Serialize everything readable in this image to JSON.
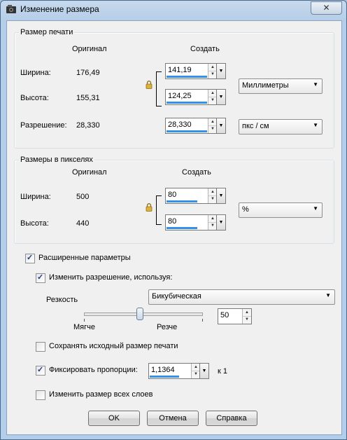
{
  "window": {
    "title": "Изменение размера",
    "close_glyph": "✕"
  },
  "print_size": {
    "group_title": "Размер печати",
    "col_original": "Оригинал",
    "col_create": "Создать",
    "width_label": "Ширина:",
    "width_original": "176,49",
    "width_value": "141,19",
    "height_label": "Высота:",
    "height_original": "155,31",
    "height_value": "124,25",
    "resolution_label": "Разрешение:",
    "resolution_original": "28,330",
    "resolution_value": "28,330",
    "units_selected": "Миллиметры",
    "res_units_selected": "пкс / см"
  },
  "pixel_size": {
    "group_title": "Размеры в пикселях",
    "col_original": "Оригинал",
    "col_create": "Создать",
    "width_label": "Ширина:",
    "width_original": "500",
    "width_value": "80",
    "height_label": "Высота:",
    "height_original": "440",
    "height_value": "80",
    "units_selected": "%"
  },
  "advanced": {
    "checkbox_label": "Расширенные параметры",
    "checked": true,
    "change_resolution_label": "Изменить разрешение, используя:",
    "change_resolution_checked": true,
    "sharpness_label": "Резкость",
    "method_selected": "Бикубическая",
    "slider_left_label": "Мягче",
    "slider_right_label": "Резче",
    "sharpness_value": "50",
    "keep_print_size_label": "Сохранять исходный размер печати",
    "keep_print_size_checked": false,
    "lock_aspect_label": "Фиксировать пропорции:",
    "lock_aspect_checked": true,
    "aspect_value": "1,1364",
    "aspect_suffix": "к 1",
    "resize_all_layers_label": "Изменить размер всех слоев",
    "resize_all_layers_checked": false
  },
  "buttons": {
    "ok": "OK",
    "cancel": "Отмена",
    "help": "Справка"
  },
  "icons": {
    "lock": "lock-icon",
    "checkmark": "checkmark-icon",
    "dropdown": "chevron-down-icon",
    "spin": "spin-arrows-icon",
    "app": "app-icon"
  }
}
